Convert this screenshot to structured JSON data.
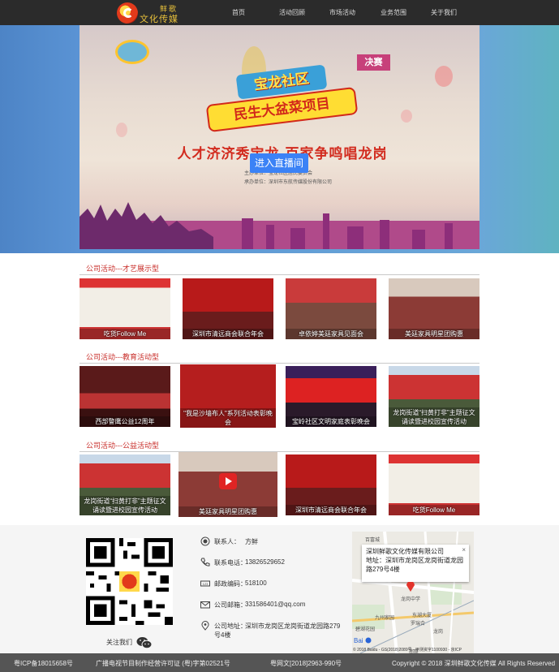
{
  "header": {
    "logo_line1": "鲜歌",
    "logo_line2": "文化传媒",
    "nav": [
      "首页",
      "活动回顾",
      "市场活动",
      "业务范围",
      "关于我们"
    ]
  },
  "banner": {
    "badge_text": "2018年\n宝福才艺大赛",
    "final_tag": "决赛",
    "title_top": "宝龙社区",
    "title_bottom": "民生大盆菜项目",
    "slogan": "人才济济秀宝龙 百家争鸣唱龙岗",
    "org_line1": "主办单位：宝龙社区居民委员会",
    "org_line2": "承办单位：深圳市东航传媒股份有限公司",
    "live_button": "进入直播间"
  },
  "sections": [
    {
      "title": "公司活动---才艺展示型",
      "items": [
        {
          "caption": "吃货Follow Me",
          "color": "#c44"
        },
        {
          "caption": "深圳市清远商会联合年会",
          "color": "#c22"
        },
        {
          "caption": "卓依婷美廷家具见面会",
          "color": "#b33"
        },
        {
          "caption": "美廷家具明星团购惠",
          "color": "#a44"
        }
      ]
    },
    {
      "title": "公司活动---教育活动型",
      "items": [
        {
          "caption": "西部警鹰公益12周年",
          "color": "#7a2222"
        },
        {
          "caption": "\"我是沙墙布人\"系列活动表彰晚会",
          "color": "#b22"
        },
        {
          "caption": "宝岭社区文明家庭表彰晚会",
          "color": "#c23"
        },
        {
          "caption": "龙岗街道“扫黄打非”主题征文诵读暨进校园宣传活动",
          "color": "#b33"
        }
      ]
    },
    {
      "title": "公司活动---公益活动型",
      "items": [
        {
          "caption": "龙岗街道“扫黄打非”主题征文诵读暨进校园宣传活动",
          "color": "#b33"
        },
        {
          "caption": "美廷家具明星团购惠",
          "color": "#a44"
        },
        {
          "caption": "深圳市清远商会联合年会",
          "color": "#c22"
        },
        {
          "caption": "吃货Follow Me",
          "color": "#c44"
        }
      ]
    }
  ],
  "footer": {
    "follow_us": "关注我们",
    "contact": {
      "person_label": "联系人：",
      "person": "方鲜",
      "phone_label": "联系电话：",
      "phone": "13826529652",
      "postcode_label": "邮政编码：",
      "postcode": "518100",
      "email_label": "公司邮箱：",
      "email": "331586401@qq.com",
      "address_label": "公司地址：",
      "address_line1": "深圳市龙岗区龙岗街道龙园路279",
      "address_line2": "号4楼"
    },
    "map": {
      "popup_title": "深圳鲜歌文化传媒有限公司",
      "popup_address_line1": "地址：深圳市龙岗区龙岗街道龙园",
      "popup_address_line2": "路279号4楼",
      "close": "×",
      "copyright": "© 2018 Baidu - GS(2018)2089号 - 甲测资字1100930 - 京ICP",
      "labels": [
        "百富城",
        "龙岗中学",
        "九州家园",
        "东湖大厦",
        "南联",
        "罗瑞合",
        "碧湖花园",
        "龙岗"
      ]
    }
  },
  "bottombar": {
    "icp": "粤ICP备18015658号",
    "license": "广播电视节目制作经营许可证 (粤)字第02521号",
    "web_license": "粤网文[2018]2963-990号",
    "copyright": "Copyright © 2018 深圳鲜歌文化传媒 All Rights Reserved"
  }
}
